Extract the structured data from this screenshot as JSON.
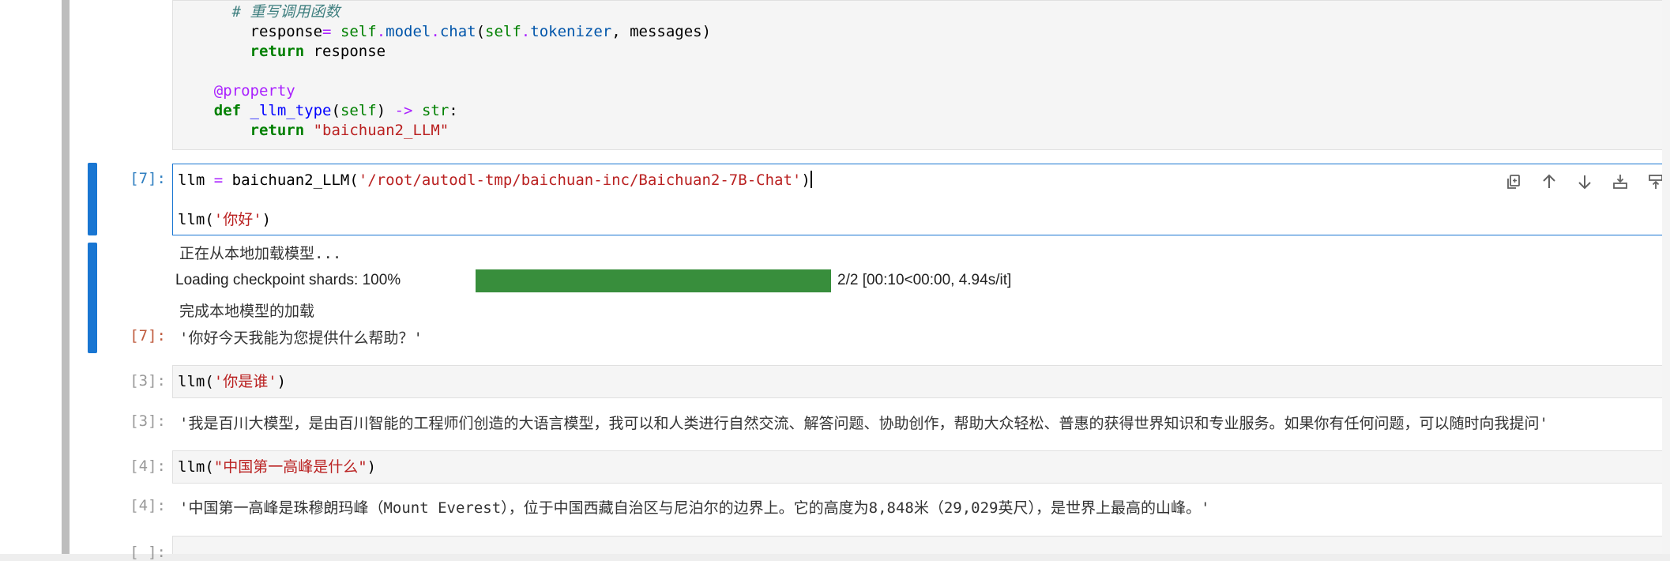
{
  "cells": {
    "cell1": {
      "lines": [
        {
          "indent": "      ",
          "parts": [
            {
              "t": "# ",
              "c": "comment"
            },
            {
              "t": "重写调用函数",
              "c": "comment"
            }
          ]
        },
        {
          "indent": "        ",
          "parts": [
            {
              "t": "response",
              "c": "plain"
            },
            {
              "t": "=",
              "c": "op"
            },
            {
              "t": " ",
              "c": "plain"
            },
            {
              "t": "self",
              "c": "bi"
            },
            {
              "t": ".",
              "c": "op"
            },
            {
              "t": "model",
              "c": "attr"
            },
            {
              "t": ".",
              "c": "op"
            },
            {
              "t": "chat",
              "c": "attr"
            },
            {
              "t": "(",
              "c": "plain"
            },
            {
              "t": "self",
              "c": "bi"
            },
            {
              "t": ".",
              "c": "op"
            },
            {
              "t": "tokenizer",
              "c": "attr"
            },
            {
              "t": ", messages)",
              "c": "plain"
            }
          ]
        },
        {
          "indent": "        ",
          "parts": [
            {
              "t": "return",
              "c": "kw"
            },
            {
              "t": " response",
              "c": "plain"
            }
          ]
        },
        {
          "indent": "",
          "parts": []
        },
        {
          "indent": "    ",
          "parts": [
            {
              "t": "@property",
              "c": "deco"
            }
          ]
        },
        {
          "indent": "    ",
          "parts": [
            {
              "t": "def",
              "c": "kw"
            },
            {
              "t": " ",
              "c": "plain"
            },
            {
              "t": "_llm_type",
              "c": "fn"
            },
            {
              "t": "(",
              "c": "plain"
            },
            {
              "t": "self",
              "c": "bi"
            },
            {
              "t": ") ",
              "c": "plain"
            },
            {
              "t": "->",
              "c": "op"
            },
            {
              "t": " ",
              "c": "plain"
            },
            {
              "t": "str",
              "c": "bi"
            },
            {
              "t": ":",
              "c": "plain"
            }
          ]
        },
        {
          "indent": "        ",
          "parts": [
            {
              "t": "return",
              "c": "kw"
            },
            {
              "t": " ",
              "c": "plain"
            },
            {
              "t": "\"baichuan2_LLM\"",
              "c": "str"
            }
          ]
        }
      ]
    },
    "cell7": {
      "prompt_in": "[7]:",
      "line1": {
        "a": "llm ",
        "b": "=",
        "c": " baichuan2_LLM(",
        "d": "'/root/autodl-tmp/baichuan-inc/Baichuan2-7B-Chat'",
        "e": ")"
      },
      "line2": {
        "a": "llm(",
        "b": "'你好'",
        "c": ")"
      },
      "output_line1": "正在从本地加载模型...",
      "progress_label": "Loading checkpoint shards: 100%",
      "progress_value": 1.0,
      "progress_stats": "2/2 [00:10<00:00, 4.94s/it]",
      "output_line3": "完成本地模型的加载",
      "prompt_out": "[7]:",
      "result": "'你好今天我能为您提供什么帮助？'"
    },
    "cell3": {
      "prompt_in": "[3]:",
      "code": {
        "a": "llm(",
        "b": "'你是谁'",
        "c": ")"
      },
      "prompt_out": "[3]:",
      "result": "'我是百川大模型，是由百川智能的工程师们创造的大语言模型，我可以和人类进行自然交流、解答问题、协助创作，帮助大众轻松、普惠的获得世界知识和专业服务。如果你有任何问题，可以随时向我提问'"
    },
    "cell4": {
      "prompt_in": "[4]:",
      "code": {
        "a": "llm(",
        "b": "\"中国第一高峰是什么\"",
        "c": ")"
      },
      "prompt_out": "[4]:",
      "result": "'中国第一高峰是珠穆朗玛峰（Mount Everest），位于中国西藏自治区与尼泊尔的边界上。它的高度为8,848米（29,029英尺），是世界上最高的山峰。'"
    },
    "cell_next": {
      "prompt_in": "[ ]:"
    }
  },
  "toolbar": {
    "icons": [
      "duplicate-icon",
      "move-up-icon",
      "move-down-icon",
      "insert-below-icon",
      "insert-above-icon",
      "delete-icon"
    ]
  },
  "colors": {
    "accent": "#1976d2",
    "progress": "#388e3c",
    "prompt_in": "#307fc1",
    "prompt_out": "#bf5b3d"
  }
}
